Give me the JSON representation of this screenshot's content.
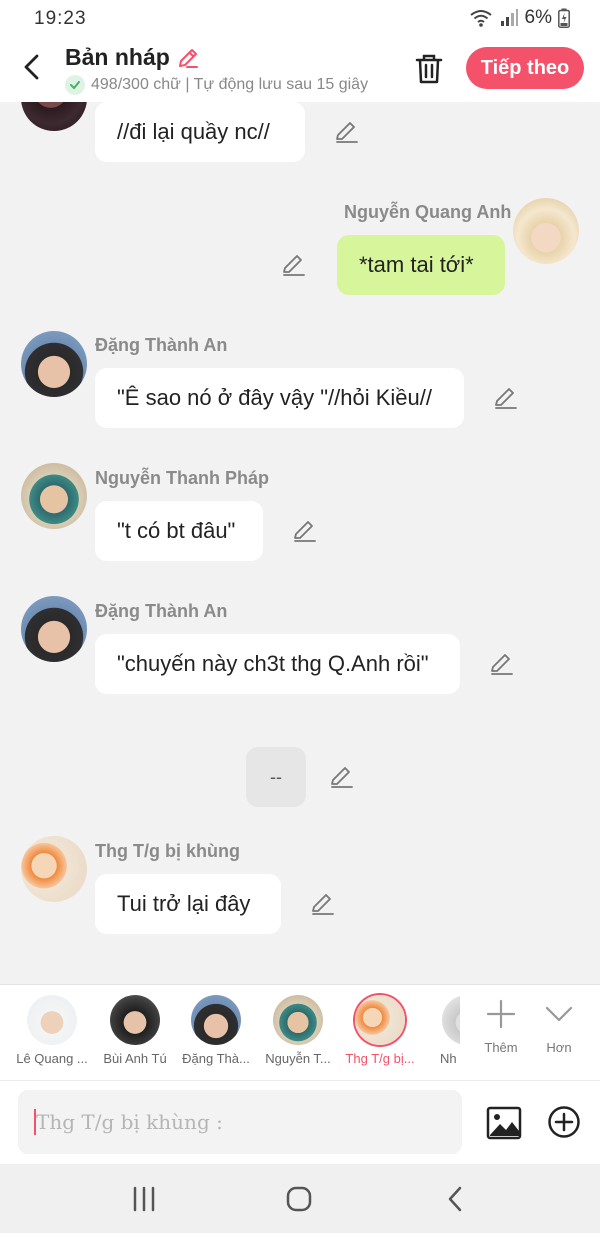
{
  "status_bar": {
    "time": "19:23",
    "battery": "6%"
  },
  "header": {
    "title": "Bản nháp",
    "subtitle": "498/300 chữ | Tự động lưu sau 15 giây",
    "next_label": "Tiếp theo"
  },
  "messages": [
    {
      "sender": "",
      "text": "//đi lại quầy nc//"
    },
    {
      "sender": "Nguyễn Quang Anh",
      "text": "*tam tai tới*"
    },
    {
      "sender": "Đặng Thành An",
      "text": "\"Ê sao nó ở đây vậy \"//hỏi Kiều//"
    },
    {
      "sender": "Nguyễn Thanh Pháp",
      "text": "\"t có bt đâu\""
    },
    {
      "sender": "Đặng Thành An",
      "text": "\"chuyến này ch3t thg Q.Anh rồi\""
    },
    {
      "sender": "",
      "text": "--"
    },
    {
      "sender": "Thg T/g bị khùng",
      "text": "Tui trở lại đây"
    }
  ],
  "characters": [
    {
      "name": "Lê Quang ..."
    },
    {
      "name": "Bùi Anh Tú"
    },
    {
      "name": "Đặng Thà..."
    },
    {
      "name": "Nguyễn T..."
    },
    {
      "name": "Thg T/g bị..."
    },
    {
      "name": "Nh"
    }
  ],
  "tools": {
    "add_label": "Thêm",
    "more_label": "Hơn"
  },
  "composer": {
    "placeholder": "Thg T/g bị khùng :"
  },
  "colors": {
    "accent": "#f4516a",
    "my_bubble": "#d7f59b",
    "background": "#f2f2f2"
  }
}
